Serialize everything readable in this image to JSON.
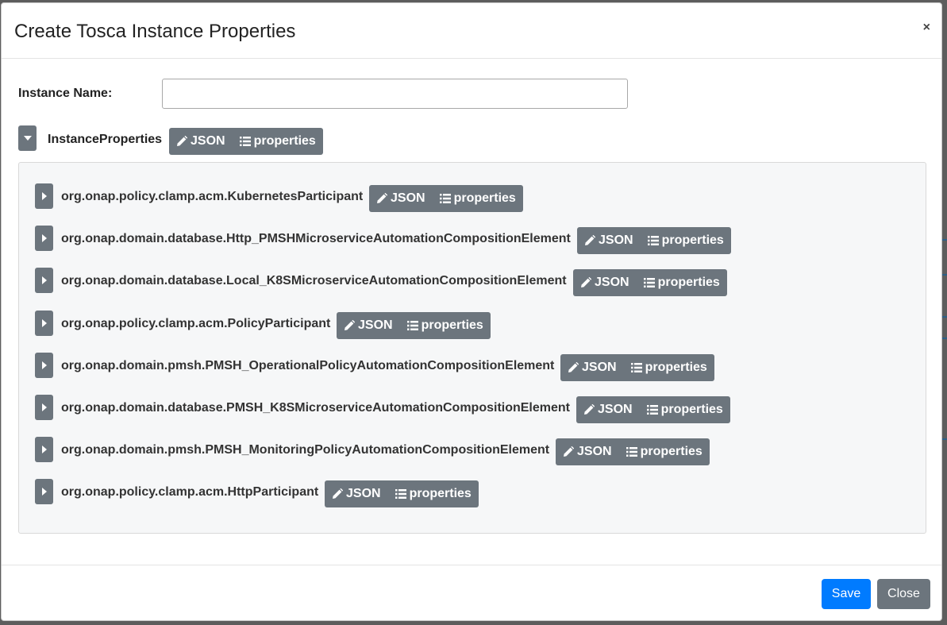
{
  "dialog": {
    "title": "Create Tosca Instance Properties",
    "close_symbol": "×"
  },
  "form": {
    "instance_name_label": "Instance Name:",
    "instance_name_value": "",
    "instance_name_placeholder": ""
  },
  "root": {
    "label": "InstanceProperties",
    "expanded": true,
    "json_label": "JSON",
    "properties_label": "properties"
  },
  "items": [
    {
      "label": "org.onap.policy.clamp.acm.KubernetesParticipant",
      "json_label": "JSON",
      "properties_label": "properties"
    },
    {
      "label": "org.onap.domain.database.Http_PMSHMicroserviceAutomationCompositionElement",
      "json_label": "JSON",
      "properties_label": "properties"
    },
    {
      "label": "org.onap.domain.database.Local_K8SMicroserviceAutomationCompositionElement",
      "json_label": "JSON",
      "properties_label": "properties"
    },
    {
      "label": "org.onap.policy.clamp.acm.PolicyParticipant",
      "json_label": "JSON",
      "properties_label": "properties"
    },
    {
      "label": "org.onap.domain.pmsh.PMSH_OperationalPolicyAutomationCompositionElement",
      "json_label": "JSON",
      "properties_label": "properties"
    },
    {
      "label": "org.onap.domain.database.PMSH_K8SMicroserviceAutomationCompositionElement",
      "json_label": "JSON",
      "properties_label": "properties"
    },
    {
      "label": "org.onap.domain.pmsh.PMSH_MonitoringPolicyAutomationCompositionElement",
      "json_label": "JSON",
      "properties_label": "properties"
    },
    {
      "label": "org.onap.policy.clamp.acm.HttpParticipant",
      "json_label": "JSON",
      "properties_label": "properties"
    }
  ],
  "footer": {
    "save_label": "Save",
    "close_label": "Close"
  },
  "colors": {
    "primary": "#007bff",
    "secondary": "#6c757d",
    "panel_bg": "#f6f7f8"
  },
  "icons": {
    "expand_open": "caret-down-icon",
    "expand_closed": "caret-right-icon",
    "json": "pencil-icon",
    "properties": "list-icon"
  }
}
